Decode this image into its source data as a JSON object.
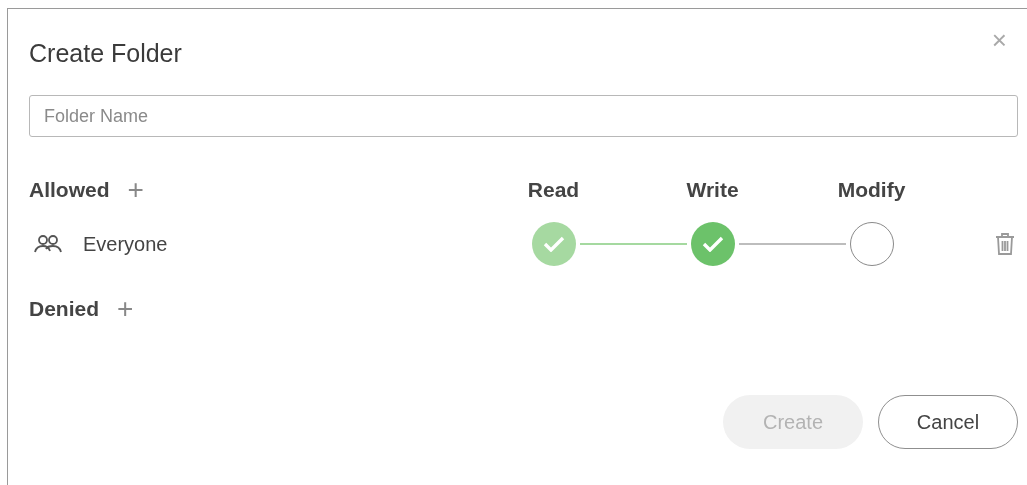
{
  "dialog": {
    "title": "Create Folder",
    "close": "×"
  },
  "folder_name": {
    "placeholder": "Folder Name"
  },
  "allowed": {
    "label": "Allowed",
    "add": "+"
  },
  "permission_columns": [
    "Read",
    "Write",
    "Modify"
  ],
  "entries": [
    {
      "name": "Everyone",
      "permissions": [
        {
          "kind": "inherited"
        },
        {
          "kind": "granted"
        },
        {
          "kind": "empty"
        }
      ]
    }
  ],
  "denied": {
    "label": "Denied",
    "add": "+"
  },
  "buttons": [
    {
      "label": "Create",
      "kind": "primary",
      "disabled": true
    },
    {
      "label": "Cancel",
      "kind": "secondary",
      "disabled": false
    }
  ]
}
